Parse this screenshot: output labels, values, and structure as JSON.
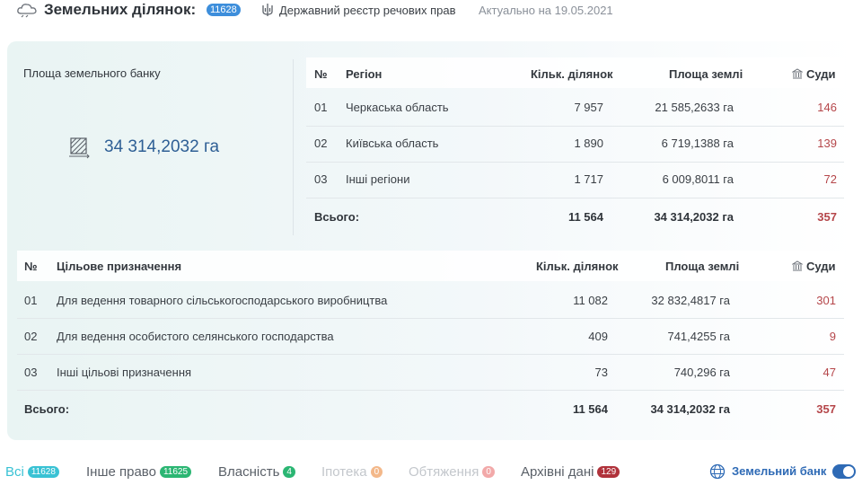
{
  "header": {
    "title": "Земельних ділянок:",
    "count": "11628",
    "registry": "Державний реєстр речових прав",
    "date": "Актуально на 19.05.2021"
  },
  "bank": {
    "title": "Площа земельного банку",
    "area": "34 314,2032 га"
  },
  "regions": {
    "headers": {
      "num": "№",
      "name": "Регіон",
      "count": "Кільк. ділянок",
      "area": "Площа землі",
      "courts": "Суди"
    },
    "rows": [
      {
        "num": "01",
        "name": "Черкаська область",
        "count": "7 957",
        "area": "21 585,2633 га",
        "courts": "146"
      },
      {
        "num": "02",
        "name": "Київська область",
        "count": "1 890",
        "area": "6 719,1388 га",
        "courts": "139"
      },
      {
        "num": "03",
        "name": "Інші регіони",
        "count": "1 717",
        "area": "6 009,8011 га",
        "courts": "72"
      }
    ],
    "total": {
      "label": "Всього:",
      "count": "11 564",
      "area": "34 314,2032 га",
      "courts": "357"
    }
  },
  "purposes": {
    "headers": {
      "num": "№",
      "name": "Цільове призначення",
      "count": "Кільк. ділянок",
      "area": "Площа землі",
      "courts": "Суди"
    },
    "rows": [
      {
        "num": "01",
        "name": "Для ведення товарного сільськогосподарського виробництва",
        "count": "11 082",
        "area": "32 832,4817 га",
        "courts": "301"
      },
      {
        "num": "02",
        "name": "Для ведення особистого селянського господарства",
        "count": "409",
        "area": "741,4255 га",
        "courts": "9"
      },
      {
        "num": "03",
        "name": "Інші цільові призначення",
        "count": "73",
        "area": "740,296 га",
        "courts": "47"
      }
    ],
    "total": {
      "label": "Всього:",
      "count": "11 564",
      "area": "34 314,2032 га",
      "courts": "357"
    }
  },
  "tabs": [
    {
      "label": "Всі",
      "badge": "11628",
      "color": "#39c2d4",
      "badge_color": "#39c2d4"
    },
    {
      "label": "Інше право",
      "badge": "11625",
      "color": "#5a6068",
      "badge_color": "#2bb673"
    },
    {
      "label": "Власність",
      "badge": "4",
      "color": "#5a6068",
      "badge_color": "#2bb673"
    },
    {
      "label": "Іпотека",
      "badge": "0",
      "color": "#c3c7cc",
      "badge_color": "#f3b88a"
    },
    {
      "label": "Обтяження",
      "badge": "0",
      "color": "#c3c7cc",
      "badge_color": "#f2a9a9"
    },
    {
      "label": "Архівні дані",
      "badge": "129",
      "color": "#5a6068",
      "badge_color": "#b0323b"
    }
  ],
  "land_bank_toggle": {
    "label": "Земельний банк",
    "on": true
  }
}
